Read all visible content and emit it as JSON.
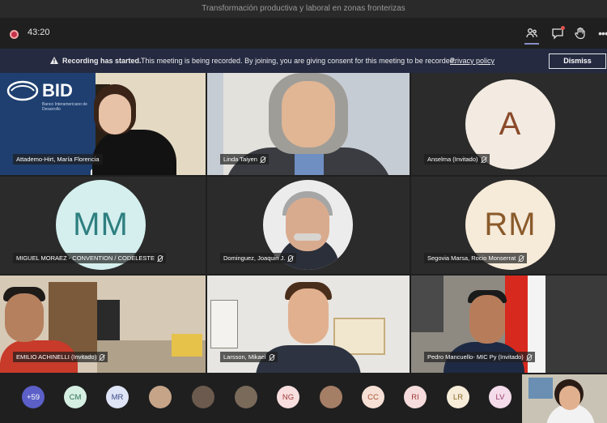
{
  "window": {
    "title": "Transformación productiva y laboral en zonas fronterizas"
  },
  "toolbar": {
    "timer": "43:20",
    "icons": [
      "record-icon",
      "people-icon",
      "chat-icon",
      "raise-hand-icon",
      "more-options-icon"
    ],
    "more_label": "•••"
  },
  "banner": {
    "title": "Recording has started.",
    "message": "This meeting is being recorded. By joining, you are giving consent for this meeting to be recorded.",
    "link": "Privacy policy",
    "dismiss": "Dismiss",
    "colors": {
      "background": "#252a41"
    }
  },
  "tiles": [
    {
      "name": "Attademo-Hirt, María Florencia",
      "type": "video",
      "logo_text": "BID",
      "logo_sub": "Banco Interamericano de Desarrollo"
    },
    {
      "name": "Linda Taiyen",
      "type": "video"
    },
    {
      "name": "Anselma (Invitado)",
      "type": "avatar",
      "initials": "A",
      "bg": "#f3ebe1",
      "fg": "#8a4a2a"
    },
    {
      "name": "MIGUEL MORAEZ - CONVENTION / CODELESTE",
      "type": "avatar",
      "initials": "MM",
      "bg": "#d4efee",
      "fg": "#2e7f80"
    },
    {
      "name": "Dominguez, Joaquin J.",
      "type": "photo"
    },
    {
      "name": "Segovia Marsa, Rocio Monserrat",
      "type": "avatar",
      "initials": "RM",
      "bg": "#f6ead9",
      "fg": "#8a5a2a"
    },
    {
      "name": "EMILIO ACHINELLI (Invitado)",
      "type": "video"
    },
    {
      "name": "Larsson, Mikael",
      "type": "video"
    },
    {
      "name": "Pedro Mancuello- MIC Py (Invitado)",
      "type": "video"
    }
  ],
  "participants_bar": [
    {
      "label": "+59",
      "bg": "#5b5fc7",
      "fg": "#ffffff"
    },
    {
      "label": "CM",
      "bg": "#d6efe3",
      "fg": "#2a6f4f"
    },
    {
      "label": "MR",
      "bg": "#dfe4f6",
      "fg": "#3b4c8a"
    },
    {
      "label": "",
      "bg": "#c6a488",
      "fg": "#ffffff",
      "photo": true
    },
    {
      "label": "",
      "bg": "#6b5a4d",
      "fg": "#ffffff",
      "photo": true
    },
    {
      "label": "",
      "bg": "#7a6a5a",
      "fg": "#ffffff",
      "photo": true
    },
    {
      "label": "NG",
      "bg": "#f8dede",
      "fg": "#a23b3b"
    },
    {
      "label": "",
      "bg": "#a57e66",
      "fg": "#ffffff",
      "photo": true
    },
    {
      "label": "CC",
      "bg": "#f6e0d6",
      "fg": "#a4512e"
    },
    {
      "label": "RI",
      "bg": "#f6dcdc",
      "fg": "#9e3a3a"
    },
    {
      "label": "LR",
      "bg": "#f6ecd8",
      "fg": "#8a6a2a"
    },
    {
      "label": "LV",
      "bg": "#f4dcea",
      "fg": "#9a3a6a"
    }
  ]
}
